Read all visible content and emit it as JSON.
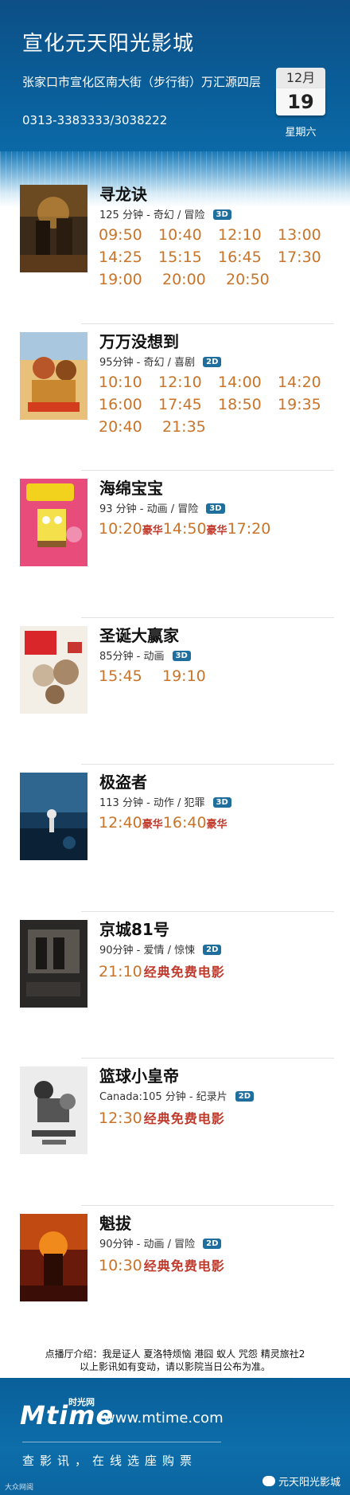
{
  "header": {
    "cinema_name": "宣化元天阳光影城",
    "address": "张家口市宣化区南大街（步行街）万汇源四层",
    "phone": "0313-3383333/3038222",
    "date": {
      "month": "12月",
      "day": "19",
      "weekday": "星期六"
    }
  },
  "movies": [
    {
      "title": "寻龙诀",
      "meta": "125 分钟 - 奇幻 / 冒险",
      "format": "3D",
      "times": [
        "09:50",
        "10:40",
        "12:10",
        "13:00",
        "14:25",
        "15:15",
        "16:45",
        "17:30",
        "19:00",
        "20:00",
        "20:50"
      ]
    },
    {
      "title": "万万没想到",
      "meta": "95分钟 - 奇幻 / 喜剧",
      "format": "2D",
      "times": [
        "10:10",
        "12:10",
        "14:00",
        "14:20",
        "16:00",
        "17:45",
        "18:50",
        "19:35",
        "20:40",
        "21:35"
      ]
    },
    {
      "title": "海绵宝宝",
      "meta": "93 分钟 - 动画 / 冒险",
      "format": "3D",
      "times": [
        "10:20",
        "14:50",
        "17:20"
      ],
      "tag": "豪华"
    },
    {
      "title": "圣诞大赢家",
      "meta": "85分钟 - 动画",
      "format": "3D",
      "times": [
        "15:45",
        "19:10"
      ]
    },
    {
      "title": "极盗者",
      "meta": "113 分钟 - 动作 / 犯罪",
      "format": "3D",
      "times": [
        "12:40",
        "16:40"
      ],
      "tag": "豪华"
    },
    {
      "title": "京城81号",
      "meta": "90分钟 - 爱情 / 惊悚",
      "format": "2D",
      "times": [
        "21:10"
      ],
      "tag": "经典免费电影"
    },
    {
      "title": "篮球小皇帝",
      "meta": "Canada:105 分钟 - 纪录片",
      "format": "2D",
      "times": [
        "12:30"
      ],
      "tag": "经典免费电影"
    },
    {
      "title": "魁拔",
      "meta": "90分钟 - 动画 / 冒险",
      "format": "2D",
      "times": [
        "10:30"
      ],
      "tag": "经典免费电影"
    }
  ],
  "notice": {
    "line1": "点播厅介绍：我是证人 夏洛特烦恼 港囧 蚁人 咒怨 精灵旅社2",
    "line2": "以上影讯如有变动，请以影院当日公布为准。"
  },
  "footer": {
    "logo": "Mtime",
    "logo_cn": "时光网",
    "url": "www.mtime.com",
    "slogan": "查影讯，在线选座购票",
    "wechat": "元天阳光影城",
    "watermark": "大众网阅"
  },
  "colors": {
    "header_blue": "#0a5d98",
    "time_orange": "#c8742a",
    "tag_red": "#c0392b",
    "format_badge": "#1e6e9e"
  }
}
